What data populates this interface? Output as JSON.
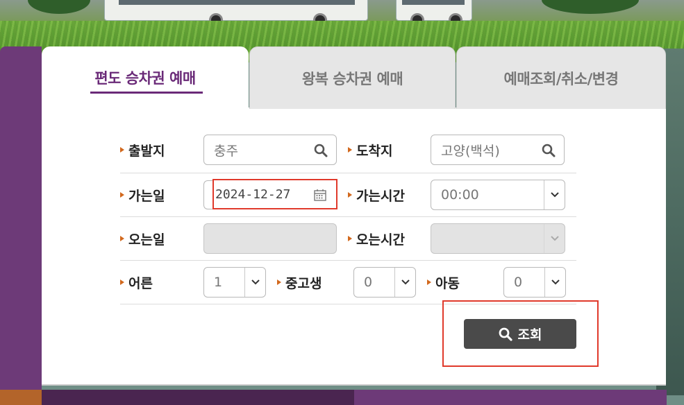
{
  "tabs": [
    {
      "label": "편도 승차권 예매",
      "active": true
    },
    {
      "label": "왕복 승차권 예매",
      "active": false
    },
    {
      "label": "예매조회/취소/변경",
      "active": false
    }
  ],
  "form": {
    "departure": {
      "label": "출발지",
      "value": "충주"
    },
    "arrival": {
      "label": "도착지",
      "value": "고양(백석)"
    },
    "depart_date": {
      "label": "가는일",
      "value": "2024-12-27"
    },
    "depart_time": {
      "label": "가는시간",
      "value": "00:00"
    },
    "return_date": {
      "label": "오는일",
      "value": ""
    },
    "return_time": {
      "label": "오는시간",
      "value": ""
    },
    "adult": {
      "label": "어른",
      "value": "1"
    },
    "student": {
      "label": "중고생",
      "value": "0"
    },
    "child": {
      "label": "아동",
      "value": "0"
    }
  },
  "search_button": {
    "label": "조회"
  },
  "colors": {
    "accent_purple": "#6a2a78",
    "highlight_red": "#e0392b",
    "arrow_orange": "#d2691e",
    "button_dark": "#4a4a4a"
  }
}
